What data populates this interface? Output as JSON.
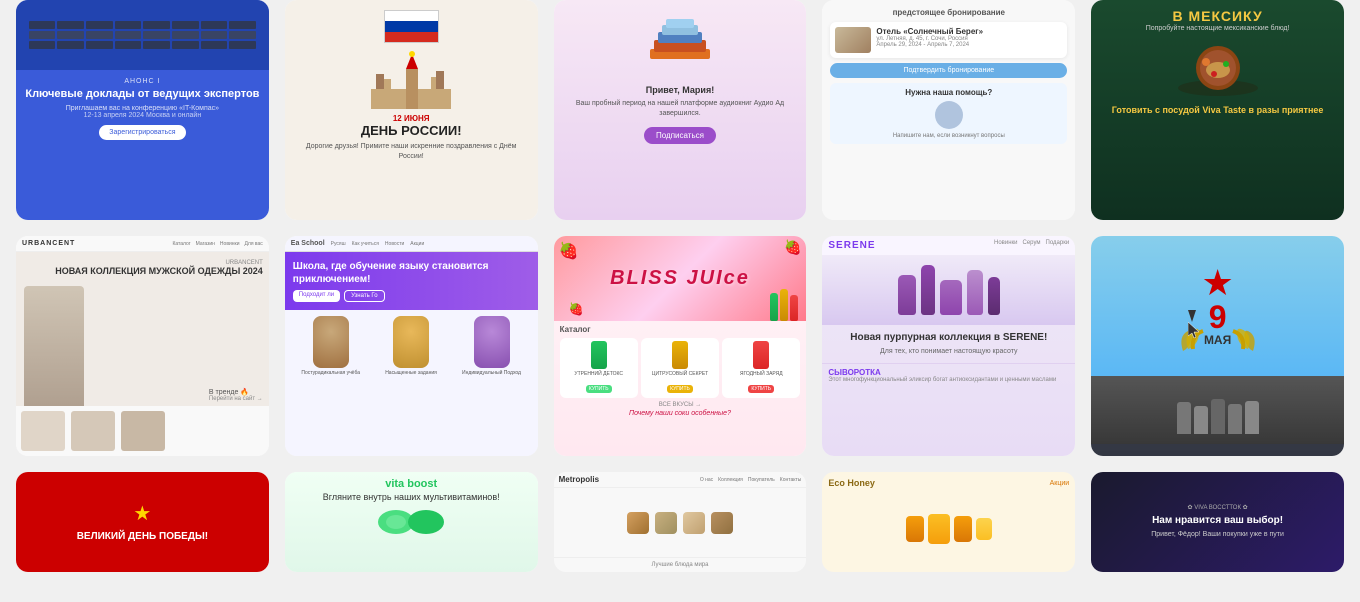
{
  "grid": {
    "rows": [
      {
        "id": "row1",
        "cards": [
          {
            "id": "card-it-conf",
            "type": "it-conference",
            "bg": "#3a5bd9",
            "tag": "АНОНС I",
            "title": "Ключевые доклады от ведущих экспертов",
            "button": "Зарегистрироваться",
            "desc": "Приглашаем вас на конференцию «IT-Компас»",
            "subdesc": "12-13 апреля 2024 Москва и онлайн"
          },
          {
            "id": "card-russia-day",
            "type": "russia-day",
            "bg": "#f5f0e8",
            "date": "12 ИЮНЯ",
            "heading": "ДЕНЬ РОССИИ!",
            "subtext": "Дорогие друзья! Примите наши искренние поздравления с Днём России!"
          },
          {
            "id": "card-books",
            "type": "books",
            "bg": "#f7e8f5",
            "greeting": "Привет, Мария!",
            "body": "Ваш пробный период на нашей платформе аудиокниг Аудио Ад завершился.",
            "button": "Подписаться"
          },
          {
            "id": "card-hotel",
            "type": "hotel-booking",
            "bg": "#f8f8f8",
            "heading": "предстоящее бронирование",
            "hotel_name": "Отель «Солнечный Берег»",
            "address": "ул. Летняя, д. 45, г. Сочи, Россия",
            "date": "Апрель 29, 2024 - Апрель 7, 2024",
            "confirm_btn": "Подтвердить бронирование",
            "support_text": "Нужна наша помощь?"
          },
          {
            "id": "card-mexico",
            "type": "mexico-food",
            "bg": "#1a4a2e",
            "accent": "#f5c842",
            "title": "В МЕКСИКУ",
            "subtitle": "Попробуйте настоящие мексиканские блюд!",
            "product": "Готовить с посудой Viva Taste в разы приятнее",
            "promo": ""
          }
        ]
      },
      {
        "id": "row2",
        "cards": [
          {
            "id": "card-urban",
            "type": "urban-fashion",
            "bg": "#f9f9f9",
            "brand": "URBANCENT",
            "nav_items": [
              "Каталог",
              "Магазин",
              "Новинки",
              "Для вас"
            ],
            "collection": "НОВАЯ КОЛЛЕКЦИЯ МУЖСКОЙ ОДЕЖДЫ 2024",
            "label": "В тренде 🔥"
          },
          {
            "id": "card-school",
            "type": "language-school",
            "bg": "#f5f5ff",
            "logo": "Ea School",
            "nav_items": [
              "Русяш",
              "Как учиться",
              "Новости",
              "Акции"
            ],
            "hero_title": "Школа, где обучение языку становится приключением!",
            "btn1": "Подходит ли",
            "btn2": "Узнать Го",
            "courses": [
              "Постурадикальная учёба",
              "Насыщенные задания",
              "Индивидуальный Подход"
            ]
          },
          {
            "id": "card-bliss",
            "type": "bliss-juice",
            "bg": "#fff0f5",
            "title": "BLISS JUIce",
            "catalog_label": "Каталог",
            "products": [
              {
                "name": "УТРЕННИЙ ДЕТОКС",
                "color": "#22c55e"
              },
              {
                "name": "ЦИТРУСОВЫЙ СЕКРЕТ",
                "color": "#eab308"
              },
              {
                "name": "ЯГОДНЫЙ ЗАРЯД",
                "color": "#ef4444"
              }
            ],
            "cta": "Почему наши соки особенные?",
            "btn_all": "ВСЕ ВКУСЫ →"
          },
          {
            "id": "card-serene",
            "type": "serene-beauty",
            "bg": "#f0eaf8",
            "brand": "SERENE",
            "nav_items": [
              "Новинки",
              "Серум",
              "Подарки"
            ],
            "collection": "Новая пурпурная коллекция в SERENE!",
            "sub": "Для тех, кто понимает настоящую красоту",
            "serum_label": "СЫВОРОТКА"
          },
          {
            "id": "card-may9",
            "type": "victory-day",
            "bg": "#87ceeb",
            "date_number": "9",
            "month": "МАЯ",
            "star": "★"
          }
        ]
      },
      {
        "id": "row3",
        "cards": [
          {
            "id": "card-victory-red",
            "type": "victory-red",
            "bg": "#cc0000",
            "text": "ВЕЛИКИЙ ДЕНЬ ПОБЕДЫ!",
            "star": "★"
          },
          {
            "id": "card-vitaboost",
            "type": "vita-boost",
            "bg": "#f0fff4",
            "brand": "vita boost",
            "heading": "Вгляните внутрь наших мультивитаминов!",
            "button": ""
          },
          {
            "id": "card-metropolis",
            "type": "metropolis",
            "bg": "#f8f8f8",
            "logo": "Metropolis",
            "nav_items": [
              "О нас",
              "Коллекция",
              "Покупатель",
              "Контакты"
            ]
          },
          {
            "id": "card-eco-honey",
            "type": "eco-honey",
            "bg": "#fdf6e3",
            "brand": "Eco Honey",
            "nav_link": "Акции"
          },
          {
            "id": "card-skin",
            "type": "skin-choice",
            "bg": "#1a1a2e",
            "tagline": "Нам нравится ваш выбор!",
            "sub": "Привет, Фёдор! Ваши покупки уже в пути"
          }
        ]
      }
    ]
  },
  "cursor": {
    "visible": true,
    "position": "right-center"
  }
}
